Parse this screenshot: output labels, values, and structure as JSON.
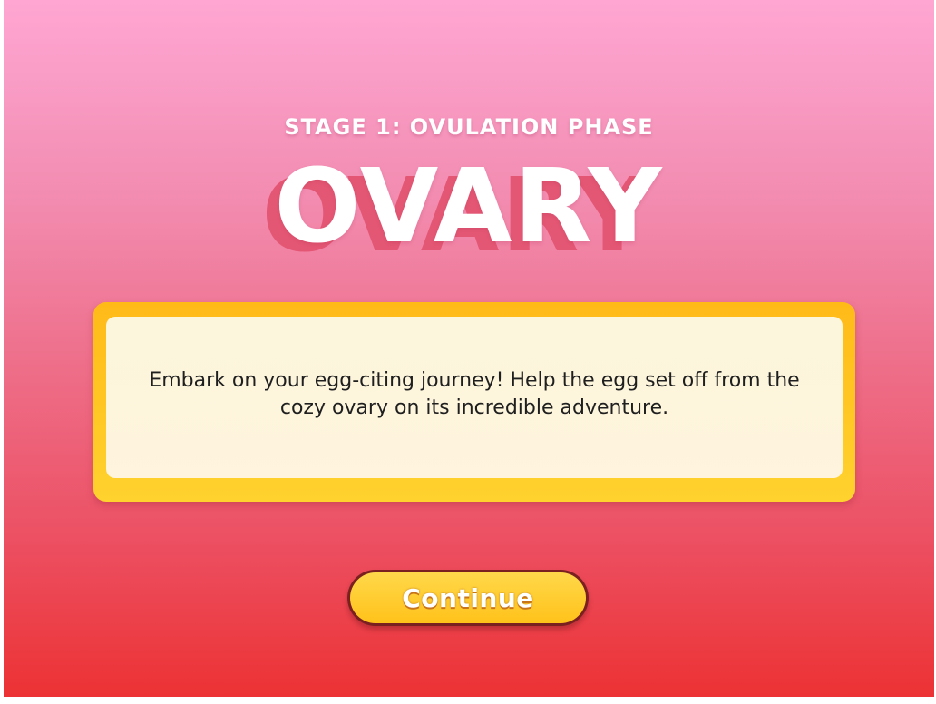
{
  "stage": {
    "label": "STAGE 1: OVULATION PHASE",
    "title": "OVARY"
  },
  "card": {
    "text": "Embark on your egg-citing journey! Help the egg set off from the cozy ovary on its incredible adventure."
  },
  "actions": {
    "continue_label": "Continue"
  },
  "colors": {
    "background_top": "#ffa6d2",
    "background_bottom": "#ec3234",
    "title_shadow": "#e45774",
    "card_border": "#ffc21a",
    "card_fill": "#fbf6dc",
    "button_fill": "#ffc21a",
    "button_outline": "#7b2020"
  }
}
